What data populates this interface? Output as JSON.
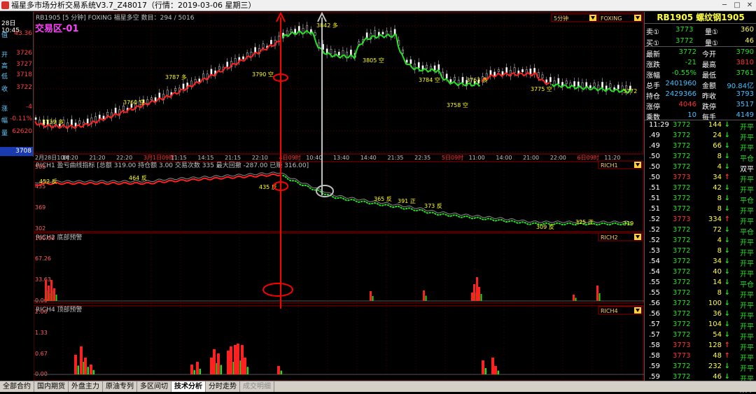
{
  "window": {
    "title": "福星多市场分析交易系统V3.7_Z48017（行情：2019-03-06 星期三）"
  },
  "left": {
    "time": "28日10:45",
    "rows": [
      {
        "k": "值",
        "v": "43.36"
      },
      {
        "k": "开",
        "v": "3726"
      },
      {
        "k": "高",
        "v": "3727"
      },
      {
        "k": "低",
        "v": "3718"
      },
      {
        "k": "收",
        "v": "3722"
      },
      {
        "k": "涨",
        "v": "-4"
      },
      {
        "k": "幅",
        "v": "-0.11%"
      },
      {
        "k": "量",
        "v": "62620"
      }
    ],
    "price": "3708"
  },
  "chart": {
    "main_header": "RB1905 [5 分钟]   FOXING 福星多空  数目：294 / 5016",
    "zone": "交易区-01",
    "period_select": "5分钟",
    "indicator_select": "FOXING",
    "rich1_header": "RICH1 盈亏曲线指标  [总额 319.00  持仓额 3.00  交易次数 335  最大回撤 -287.00  已赚 316.00]",
    "rich1_tag": "RICH1",
    "rich2_header": "RICH2 底部预警",
    "rich2_tag": "RICH2",
    "rich4_header": "RICH4 顶部预警",
    "rich4_tag": "RICH4",
    "price_annots": [
      "3739 多",
      "3760 空",
      "3787 多",
      "3790 空",
      "3842 多",
      "3805 空",
      "3784 空",
      "3763 多",
      "3758 空",
      "3775 空",
      "3772"
    ],
    "rich1_annots": [
      "452 反",
      "464 反",
      "435 反",
      "365 反",
      "391 正",
      "373 反",
      "309 反",
      "325 正",
      "319"
    ],
    "rich1_axis": [
      "508",
      "435",
      "369",
      "302"
    ],
    "rich2_axis": [
      "100.00",
      "67.26",
      "33.63",
      "0.00"
    ],
    "rich4_axis": [
      "2.00",
      "1.33",
      "0.67",
      "0.00"
    ],
    "time_labels": [
      "2月28日10时",
      "14:20",
      "21:20",
      "22:20",
      "3月1日09时",
      "11:15",
      "14:15",
      "21:15",
      "22:10",
      "4日09时",
      "10:40",
      "13:40",
      "14:40",
      "21:35",
      "22:35",
      "5日09时",
      "11:00",
      "14:00",
      "21:00",
      "22:00",
      "6日09时",
      "11:20"
    ],
    "colors": {
      "up": "#ff2020",
      "down": "#20e020",
      "annot": "#ffff00",
      "marker": "#ff0000",
      "gray": "#c0c0c0"
    }
  },
  "quote": {
    "title": "RB1905  螺纹钢1905",
    "sell": {
      "label": "卖①",
      "price": "3773",
      "qlabel": "量①",
      "qty": "360"
    },
    "buy": {
      "label": "买①",
      "price": "3772",
      "qlabel": "量①",
      "qty": "46"
    },
    "rows": [
      {
        "k1": "最新",
        "v1": "3772",
        "k2": "今开",
        "v2": "3790"
      },
      {
        "k1": "涨跌",
        "v1": "-21",
        "k2": "最高",
        "v2": "3810"
      },
      {
        "k1": "涨幅",
        "v1": "-0.55%",
        "k2": "最低",
        "v2": "3761"
      },
      {
        "k1": "总手",
        "v1": "2401960",
        "k2": "金额",
        "v2": "90.84亿"
      },
      {
        "k1": "持仓",
        "v1": "2429366",
        "k2": "昨收",
        "v2": "3793"
      },
      {
        "k1": "涨停",
        "v1": "4046",
        "k2": "跌停",
        "v2": "3517"
      },
      {
        "k1": "乘数",
        "v1": "10",
        "k2": "每手",
        "v2": "4149"
      }
    ]
  },
  "ticks": [
    {
      "t": "11:29",
      "p": "3772",
      "q": "144",
      "d": "down",
      "a": "开平"
    },
    {
      "t": ".49",
      "p": "3772",
      "q": "24",
      "d": "down",
      "a": "开平"
    },
    {
      "t": ".49",
      "p": "3772",
      "q": "66",
      "d": "down",
      "a": "开平"
    },
    {
      "t": ".50",
      "p": "3772",
      "q": "8",
      "d": "down",
      "a": "平仓"
    },
    {
      "t": ".50",
      "p": "3772",
      "q": "4",
      "d": "down",
      "a": "双平"
    },
    {
      "t": ".50",
      "p": "3773",
      "q": "34",
      "d": "up",
      "a": "开平"
    },
    {
      "t": ".51",
      "p": "3772",
      "q": "42",
      "d": "down",
      "a": "开平"
    },
    {
      "t": ".51",
      "p": "3772",
      "q": "8",
      "d": "down",
      "a": "平仓"
    },
    {
      "t": ".51",
      "p": "3772",
      "q": "8",
      "d": "down",
      "a": "开平"
    },
    {
      "t": ".52",
      "p": "3773",
      "q": "334",
      "d": "up",
      "a": "开平"
    },
    {
      "t": ".52",
      "p": "3772",
      "q": "72",
      "d": "down",
      "a": "平仓"
    },
    {
      "t": ".52",
      "p": "3772",
      "q": "4",
      "d": "down",
      "a": "开平"
    },
    {
      "t": ".53",
      "p": "3772",
      "q": "8",
      "d": "down",
      "a": "开平"
    },
    {
      "t": ".54",
      "p": "3772",
      "q": "34",
      "d": "down",
      "a": "开平"
    },
    {
      "t": ".54",
      "p": "3772",
      "q": "40",
      "d": "down",
      "a": "开平"
    },
    {
      "t": ".55",
      "p": "3772",
      "q": "14",
      "d": "down",
      "a": "平仓"
    },
    {
      "t": ".55",
      "p": "3772",
      "q": "8",
      "d": "down",
      "a": "开平"
    },
    {
      "t": ".56",
      "p": "3772",
      "q": "100",
      "d": "down",
      "a": "开平"
    },
    {
      "t": ".56",
      "p": "3772",
      "q": "36",
      "d": "down",
      "a": "开平"
    },
    {
      "t": ".57",
      "p": "3772",
      "q": "104",
      "d": "down",
      "a": "开平"
    },
    {
      "t": ".57",
      "p": "3772",
      "q": "54",
      "d": "down",
      "a": "开平"
    },
    {
      "t": ".58",
      "p": "3773",
      "q": "128",
      "d": "up",
      "a": "开平"
    },
    {
      "t": ".58",
      "p": "3773",
      "q": "48",
      "d": "up",
      "a": "开平"
    },
    {
      "t": ".59",
      "p": "3772",
      "q": "232",
      "d": "down",
      "a": "开平"
    },
    {
      "t": ".59",
      "p": "3772",
      "q": "46",
      "d": "down",
      "a": "开平"
    },
    {
      "t": "11:30",
      "p": "3772",
      "q": "24",
      "d": "down",
      "a": "双平"
    }
  ],
  "tabs": [
    "全部合约",
    "国内期货",
    "外盘主力",
    "原油专列",
    "多区间切",
    "技术分析",
    "分时走势",
    "成交明细"
  ],
  "active_tab": 5
}
